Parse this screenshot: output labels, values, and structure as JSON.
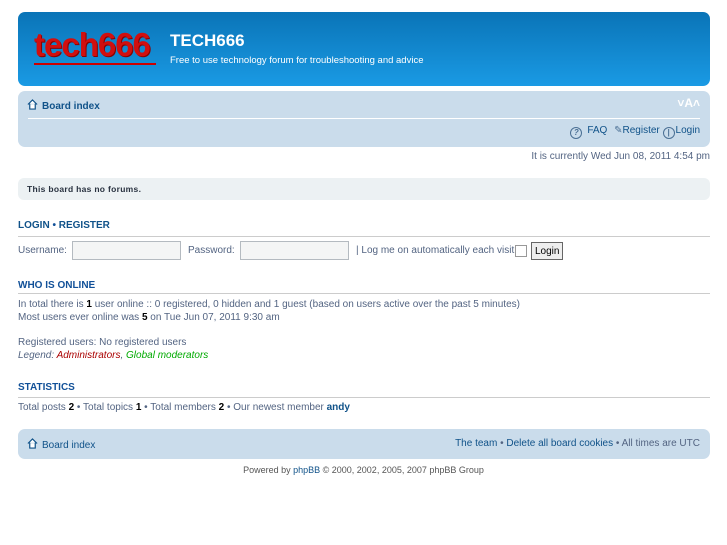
{
  "header": {
    "logo_text": "tech666",
    "title": "TECH666",
    "description": "Free to use technology forum for troubleshooting and advice"
  },
  "navbar": {
    "board_index": "Board index",
    "font_size": "˅A˄",
    "faq": "FAQ",
    "register": "Register",
    "login": "Login"
  },
  "time": "It is currently Wed Jun 08, 2011 4:54 pm",
  "info": "This board has no forums.",
  "login_section": {
    "login": "LOGIN",
    "sep": "•",
    "register": "REGISTER",
    "username_label": "Username:",
    "username_value": "",
    "password_label": "Password:",
    "password_value": "",
    "remember_label": "| Log me on automatically each visit",
    "remember_checked": false,
    "login_button": "Login"
  },
  "online": {
    "title": "WHO IS ONLINE",
    "l1a": "In total there is ",
    "l1b": "1",
    "l1c": " user online :: 0 registered, 0 hidden and 1 guest (based on users active over the past 5 minutes)",
    "l2a": "Most users ever online was ",
    "l2b": "5",
    "l2c": " on Tue Jun 07, 2011 9:30 am",
    "registered": "Registered users: No registered users",
    "legend": "Legend: ",
    "admins": "Administrators",
    "comma": ", ",
    "mods": "Global moderators",
    "admin_color": "#aa0000",
    "mod_color": "#00aa00"
  },
  "stats": {
    "title": "STATISTICS",
    "a": "Total posts ",
    "posts": "2",
    "b": " • Total topics ",
    "topics": "1",
    "c": " • Total members ",
    "members": "2",
    "d": " • Our newest member ",
    "newest": "andy"
  },
  "footer": {
    "board_index": "Board index",
    "team": "The team",
    "sep1": " • ",
    "cookies": "Delete all board cookies",
    "sep2": " • ",
    "times": "All times are UTC"
  },
  "powered": {
    "a": "Powered by ",
    "phpbb": "phpBB",
    "b": " © 2000, 2002, 2005, 2007 phpBB Group"
  }
}
